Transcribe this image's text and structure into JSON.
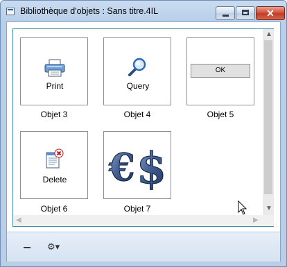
{
  "window": {
    "title": "Bibliothèque d'objets : Sans titre.4IL"
  },
  "tiles": [
    {
      "label": "Print",
      "caption": "Objet 3",
      "icon": "printer-icon"
    },
    {
      "label": "Query",
      "caption": "Objet 4",
      "icon": "magnifier-icon"
    },
    {
      "label": "OK",
      "caption": "Objet 5",
      "icon": "button-preview"
    },
    {
      "label": "Delete",
      "caption": "Objet 6",
      "icon": "delete-document-icon"
    },
    {
      "label": "",
      "caption": "Objet 7",
      "icon": "euro-dollar-icon"
    }
  ],
  "bottom_bar": {
    "remove_icon": "minus-icon",
    "options_icon": "gear-icon"
  },
  "colors": {
    "title_bg": "#c9dbf0",
    "close_button": "#c23a22",
    "panel_border": "#3c8aa3"
  }
}
